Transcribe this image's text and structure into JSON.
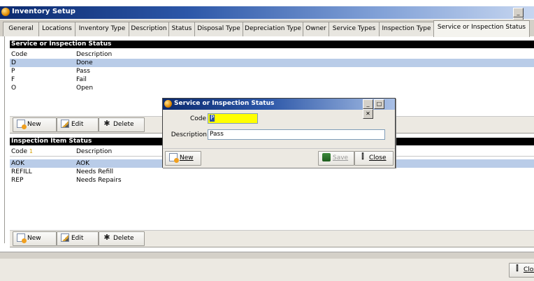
{
  "window": {
    "title": "Inventory Setup"
  },
  "tabs": [
    "General",
    "Locations",
    "Inventory Type",
    "Description",
    "Status",
    "Disposal Type",
    "Depreciation Type",
    "Owner",
    "Service Types",
    "Inspection Type",
    "Service or Inspection Status"
  ],
  "active_tab": "Service or Inspection Status",
  "status_section": {
    "header": "Service or Inspection Status",
    "columns": [
      "Code",
      "Description"
    ],
    "rows": [
      {
        "code": "D",
        "description": "Done"
      },
      {
        "code": "P",
        "description": "Pass"
      },
      {
        "code": "F",
        "description": "Fail"
      },
      {
        "code": "O",
        "description": "Open"
      }
    ],
    "buttons": {
      "new": "New",
      "edit": "Edit",
      "delete": "Delete"
    }
  },
  "item_section": {
    "header": "Inspection Item Status",
    "columns": [
      "Code",
      "Description"
    ],
    "sort_indicator": "1",
    "rows": [
      {
        "code": "AOK",
        "description": "AOK"
      },
      {
        "code": "REFILL",
        "description": "Needs Refill"
      },
      {
        "code": "REP",
        "description": "Needs Repairs"
      }
    ],
    "buttons": {
      "new": "New",
      "edit": "Edit",
      "delete": "Delete"
    }
  },
  "dialog": {
    "title": "Service or Inspection Status",
    "code_label": "Code",
    "code_value": "P",
    "description_label": "Description",
    "description_value": "Pass",
    "new_button": "New",
    "save_button": "Save",
    "close_button": "Close"
  },
  "bottom": {
    "close_button": "Close"
  },
  "colors": {
    "title_start": "#0b2a6f",
    "selected_row": "#b9cce8",
    "code_field_highlight": "#ffff00"
  }
}
